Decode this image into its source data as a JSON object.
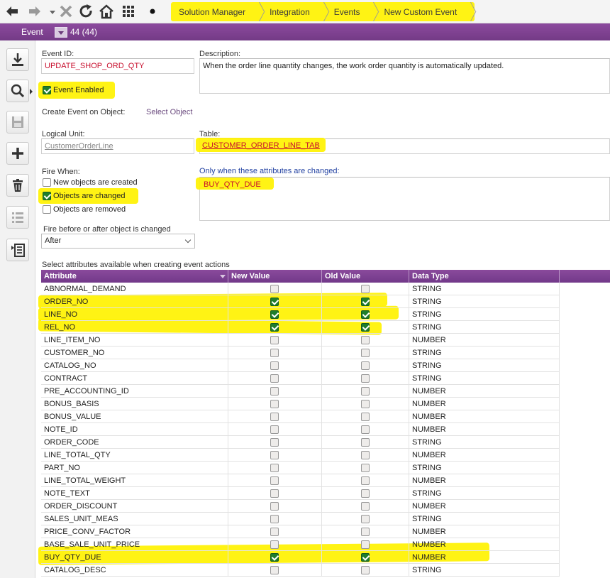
{
  "breadcrumbs": [
    "Solution Manager",
    "Integration",
    "Events",
    "New Custom Event"
  ],
  "title_bar": {
    "label": "Event",
    "count": "44 (44)"
  },
  "form": {
    "event_id_label": "Event ID:",
    "event_id_value": "UPDATE_SHOP_ORD_QTY",
    "description_label": "Description:",
    "description_value": "When the order line quantity changes, the work order quantity is automatically updated.",
    "event_enabled_label": "Event Enabled",
    "event_enabled": true,
    "create_event_label": "Create Event on Object:",
    "select_object_link": "Select Object",
    "logical_unit_label": "Logical Unit:",
    "logical_unit_value": "CustomerOrderLine",
    "table_label": "Table:",
    "table_value": "CUSTOMER_ORDER_LINE_TAB",
    "fire_when_label": "Fire When:",
    "fire_options": [
      {
        "label": "New objects are created",
        "checked": false
      },
      {
        "label": "Objects are changed",
        "checked": true
      },
      {
        "label": "Objects are removed",
        "checked": false
      }
    ],
    "only_when_label": "Only when these attributes are changed:",
    "only_when_value": "BUY_QTY_DUE",
    "fire_before_after_label": "Fire before or after object is changed",
    "fire_before_after_value": "After",
    "select_attributes_label": "Select attributes available when creating event actions"
  },
  "table": {
    "headers": [
      "Attribute",
      "New Value",
      "Old Value",
      "Data Type"
    ],
    "rows": [
      {
        "attr": "ABNORMAL_DEMAND",
        "new": false,
        "old": false,
        "type": "STRING"
      },
      {
        "attr": "ORDER_NO",
        "new": true,
        "old": true,
        "type": "STRING"
      },
      {
        "attr": "LINE_NO",
        "new": true,
        "old": true,
        "type": "STRING"
      },
      {
        "attr": "REL_NO",
        "new": true,
        "old": true,
        "type": "STRING"
      },
      {
        "attr": "LINE_ITEM_NO",
        "new": false,
        "old": false,
        "type": "NUMBER"
      },
      {
        "attr": "CUSTOMER_NO",
        "new": false,
        "old": false,
        "type": "STRING"
      },
      {
        "attr": "CATALOG_NO",
        "new": false,
        "old": false,
        "type": "STRING"
      },
      {
        "attr": "CONTRACT",
        "new": false,
        "old": false,
        "type": "STRING"
      },
      {
        "attr": "PRE_ACCOUNTING_ID",
        "new": false,
        "old": false,
        "type": "NUMBER"
      },
      {
        "attr": "BONUS_BASIS",
        "new": false,
        "old": false,
        "type": "NUMBER"
      },
      {
        "attr": "BONUS_VALUE",
        "new": false,
        "old": false,
        "type": "NUMBER"
      },
      {
        "attr": "NOTE_ID",
        "new": false,
        "old": false,
        "type": "NUMBER"
      },
      {
        "attr": "ORDER_CODE",
        "new": false,
        "old": false,
        "type": "STRING"
      },
      {
        "attr": "LINE_TOTAL_QTY",
        "new": false,
        "old": false,
        "type": "NUMBER"
      },
      {
        "attr": "PART_NO",
        "new": false,
        "old": false,
        "type": "STRING"
      },
      {
        "attr": "LINE_TOTAL_WEIGHT",
        "new": false,
        "old": false,
        "type": "NUMBER"
      },
      {
        "attr": "NOTE_TEXT",
        "new": false,
        "old": false,
        "type": "STRING"
      },
      {
        "attr": "ORDER_DISCOUNT",
        "new": false,
        "old": false,
        "type": "NUMBER"
      },
      {
        "attr": "SALES_UNIT_MEAS",
        "new": false,
        "old": false,
        "type": "STRING"
      },
      {
        "attr": "PRICE_CONV_FACTOR",
        "new": false,
        "old": false,
        "type": "NUMBER"
      },
      {
        "attr": "BASE_SALE_UNIT_PRICE",
        "new": false,
        "old": false,
        "type": "NUMBER"
      },
      {
        "attr": "BUY_QTY_DUE",
        "new": true,
        "old": true,
        "type": "NUMBER"
      },
      {
        "attr": "CATALOG_DESC",
        "new": false,
        "old": false,
        "type": "STRING"
      }
    ]
  },
  "colors": {
    "accent_purple": "#7b3f8f",
    "highlight": "#fff200",
    "check_green": "#1e7d2c"
  }
}
